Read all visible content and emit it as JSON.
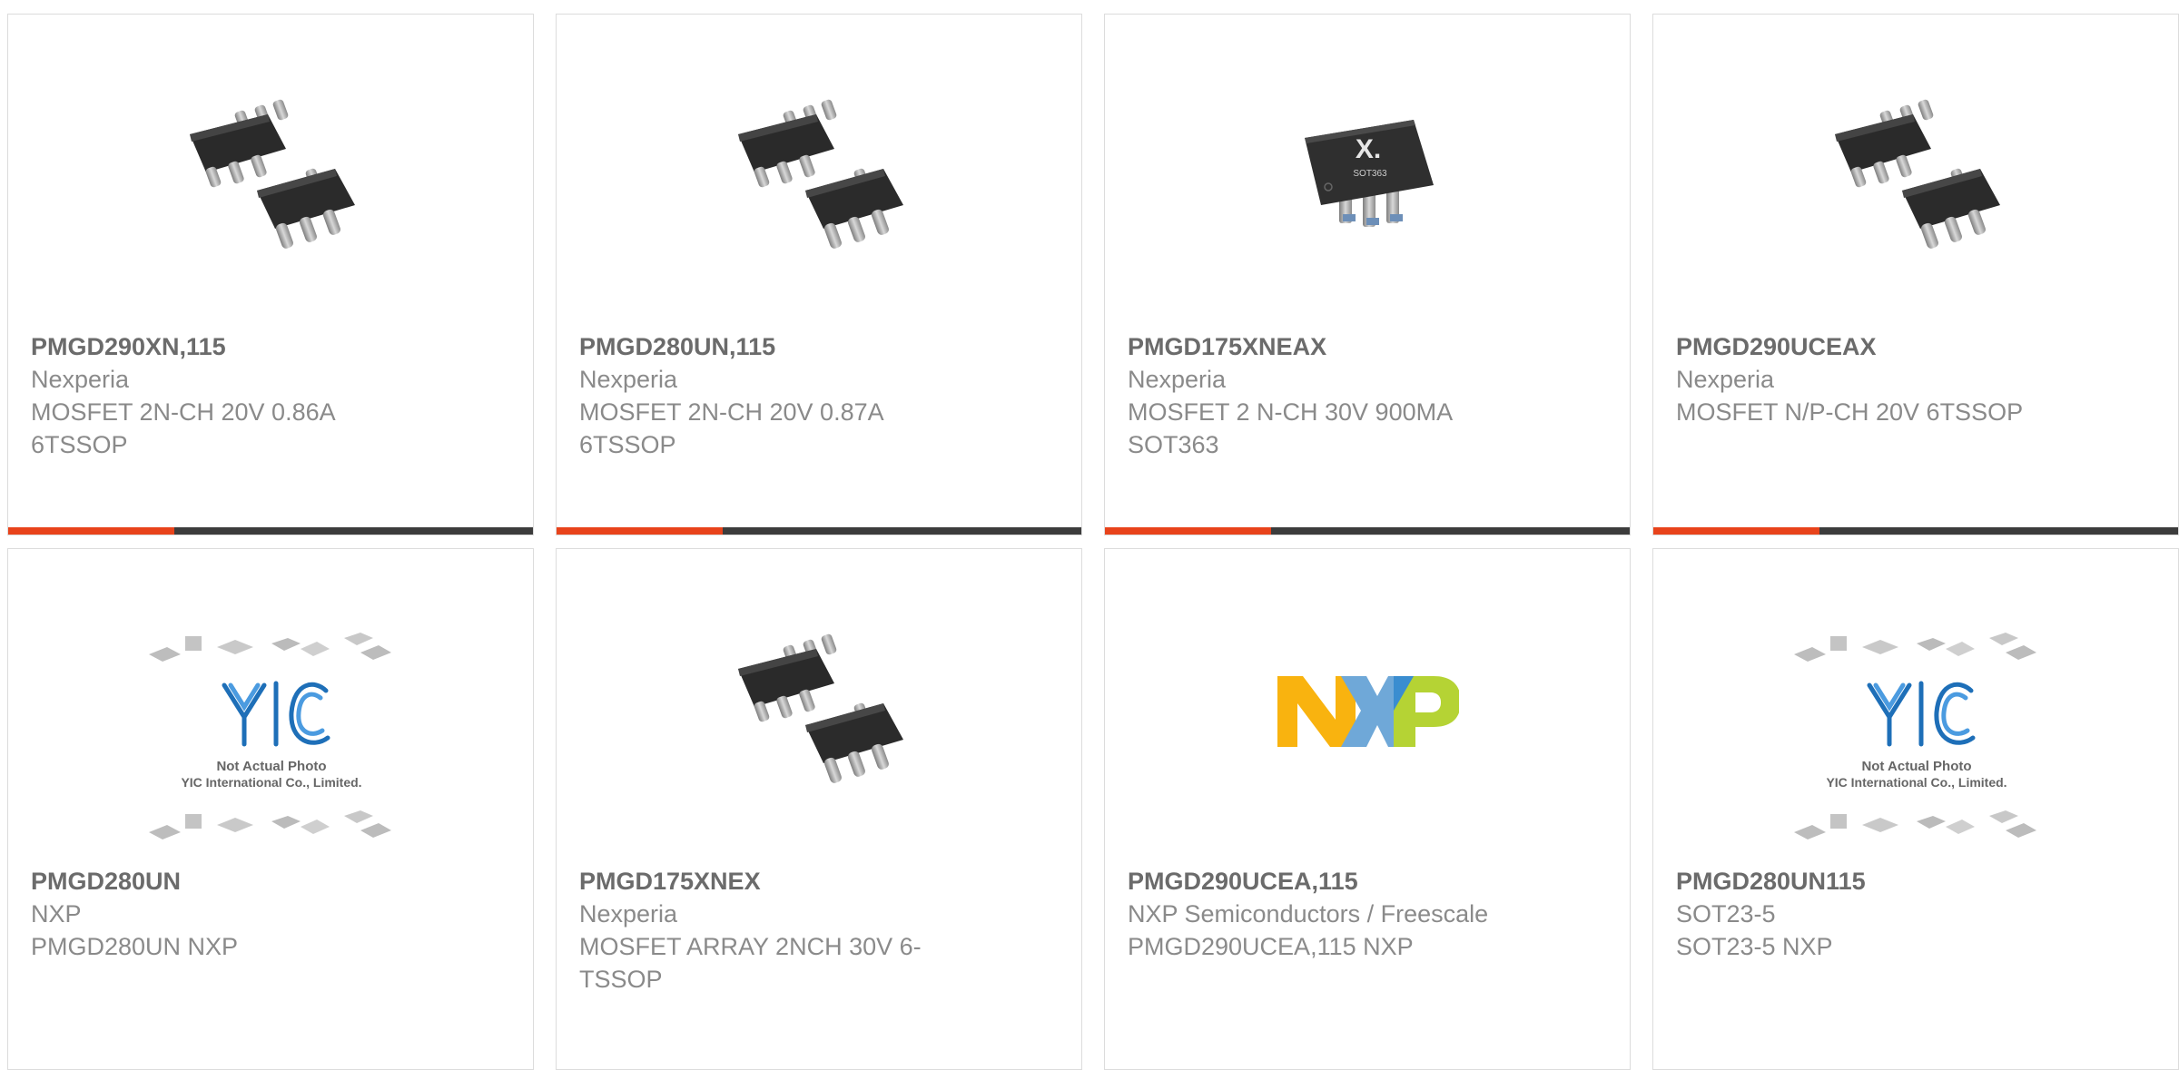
{
  "colors": {
    "accent": "#e8431b",
    "bar": "#3c3c3c",
    "part_number": "#6b6b6b",
    "text": "#8a8a8a"
  },
  "products": [
    {
      "part_number": "PMGD290XN,115",
      "manufacturer": "Nexperia",
      "description": "MOSFET 2N-CH 20V 0.86A 6TSSOP",
      "image": "tssop-chips-icon"
    },
    {
      "part_number": "PMGD280UN,115",
      "manufacturer": "Nexperia",
      "description": "MOSFET 2N-CH 20V 0.87A 6TSSOP",
      "image": "tssop-chips-icon"
    },
    {
      "part_number": "PMGD175XNEAX",
      "manufacturer": "Nexperia",
      "description": "MOSFET 2 N-CH 30V 900MA SOT363",
      "image": "sot363-chip-icon",
      "chip_text": "X.",
      "chip_subtext": "SOT363"
    },
    {
      "part_number": "PMGD290UCEAX",
      "manufacturer": "Nexperia",
      "description": "MOSFET N/P-CH 20V 6TSSOP",
      "image": "tssop-chips-icon"
    },
    {
      "part_number": "PMGD280UN",
      "manufacturer": "NXP",
      "description": "PMGD280UN NXP",
      "image": "yic-placeholder-icon",
      "placeholder_logo": "YIC",
      "placeholder_line1": "Not Actual Photo",
      "placeholder_line2": "YIC International Co., Limited."
    },
    {
      "part_number": "PMGD175XNEX",
      "manufacturer": "Nexperia",
      "description": "MOSFET ARRAY 2NCH 30V 6-TSSOP",
      "image": "tssop-chips-icon"
    },
    {
      "part_number": "PMGD290UCEA,115",
      "manufacturer": "NXP Semiconductors / Freescale",
      "description": "PMGD290UCEA,115 NXP",
      "image": "nxp-logo-icon"
    },
    {
      "part_number": "PMGD280UN115",
      "manufacturer": "SOT23-5",
      "description": "SOT23-5 NXP",
      "image": "yic-placeholder-icon",
      "placeholder_logo": "YIC",
      "placeholder_line1": "Not Actual Photo",
      "placeholder_line2": "YIC International Co., Limited."
    }
  ]
}
